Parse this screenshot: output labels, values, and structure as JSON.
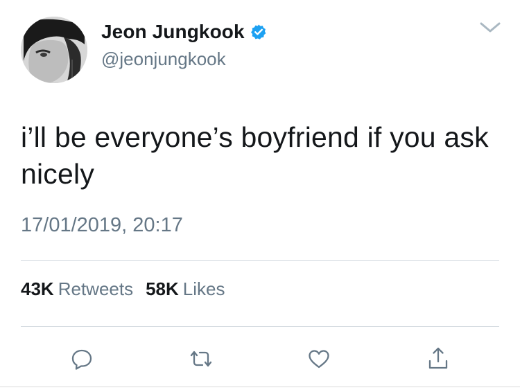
{
  "tweet": {
    "author": {
      "display_name": "Jeon Jungkook",
      "handle": "@jeonjungkook",
      "verified": true
    },
    "text": "i’ll be everyone’s boyfriend if you ask nicely",
    "timestamp": "17/01/2019, 20:17",
    "stats": {
      "retweets_count": "43K",
      "retweets_label": "Retweets",
      "likes_count": "58K",
      "likes_label": "Likes"
    },
    "actions": [
      "reply-icon",
      "retweet-icon",
      "like-icon",
      "share-icon"
    ]
  },
  "colors": {
    "text": "#14171a",
    "secondary": "#657786",
    "verified_blue": "#1da1f2",
    "divider": "#cfd6dc"
  }
}
